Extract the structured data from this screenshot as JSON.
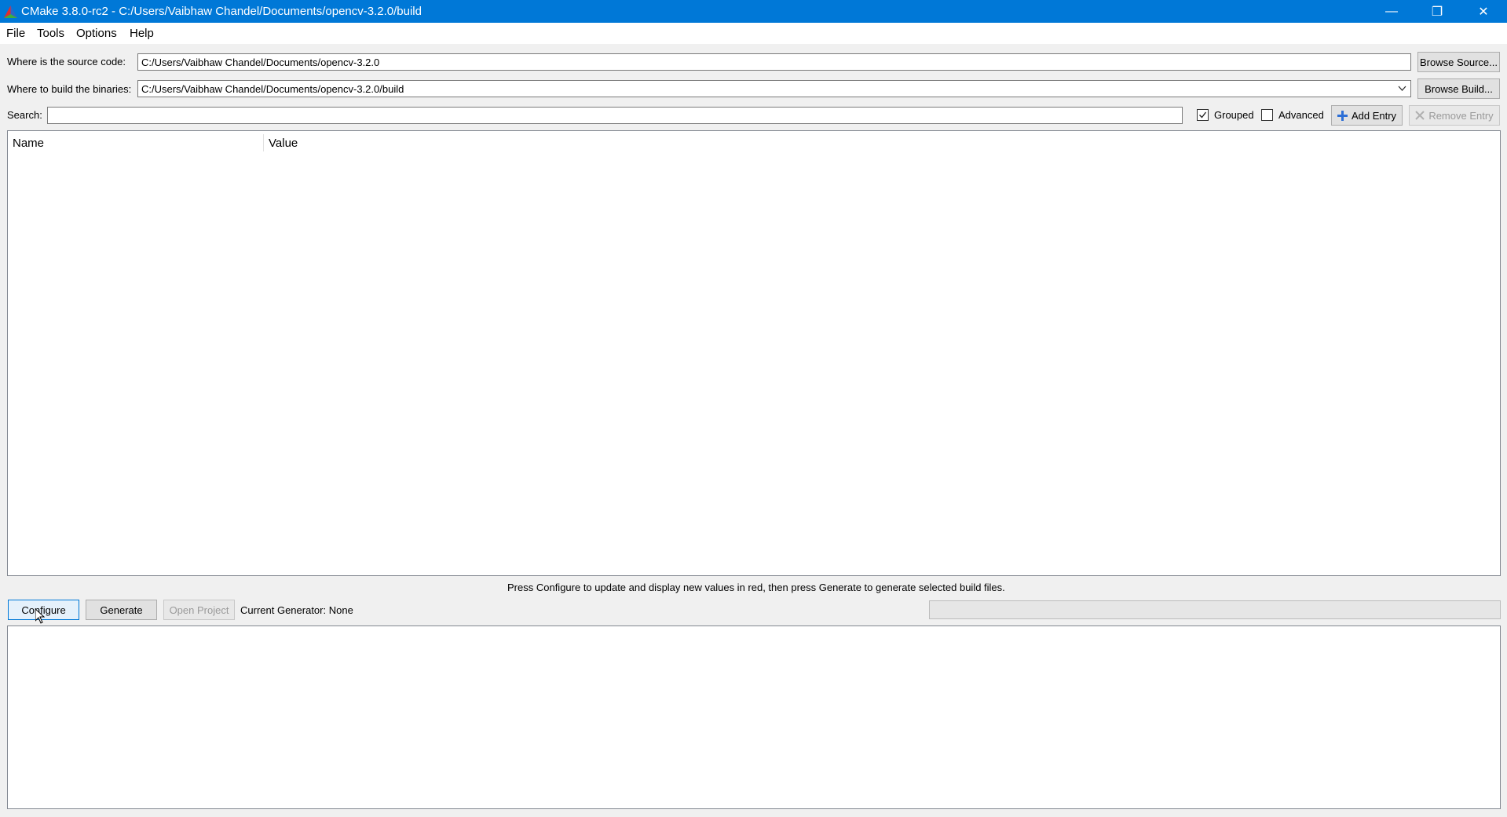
{
  "window": {
    "title": "CMake 3.8.0-rc2 - C:/Users/Vaibhaw Chandel/Documents/opencv-3.2.0/build",
    "minimize_glyph": "—",
    "restore_glyph": "❐",
    "close_glyph": "✕"
  },
  "menu": {
    "file": "File",
    "tools": "Tools",
    "options": "Options",
    "help": "Help"
  },
  "source": {
    "label": "Where is the source code:",
    "value": "C:/Users/Vaibhaw Chandel/Documents/opencv-3.2.0",
    "browse_label": "Browse Source..."
  },
  "build": {
    "label": "Where to build the binaries:",
    "value": "C:/Users/Vaibhaw Chandel/Documents/opencv-3.2.0/build",
    "browse_label": "Browse Build..."
  },
  "search": {
    "label": "Search:",
    "value": "",
    "grouped_label": "Grouped",
    "grouped_checked": true,
    "advanced_label": "Advanced",
    "advanced_checked": false,
    "add_entry_label": "Add Entry",
    "remove_entry_label": "Remove Entry"
  },
  "table": {
    "columns": [
      "Name",
      "Value"
    ],
    "rows": []
  },
  "status": {
    "message": "Press Configure to update and display new values in red, then press Generate to generate selected build files."
  },
  "actions": {
    "configure_label": "Configure",
    "generate_label": "Generate",
    "open_project_label": "Open Project",
    "current_generator": "Current Generator: None"
  },
  "progress": {
    "value": 0
  },
  "colors": {
    "titlebar": "#0078d7",
    "accent": "#0078d7"
  }
}
